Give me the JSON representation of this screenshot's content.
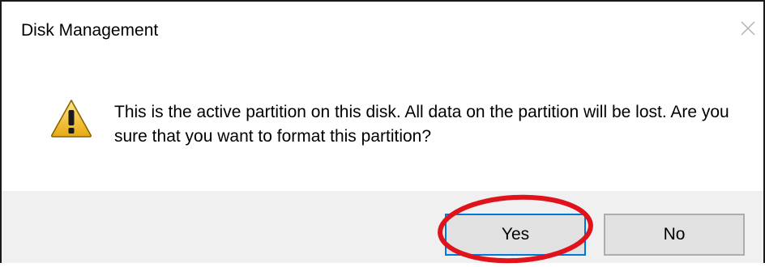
{
  "dialog": {
    "title": "Disk Management",
    "close_icon": "close-icon",
    "warning_icon": "warning-triangle-icon",
    "message": "This is the active partition on this disk. All data on the partition will be lost. Are you sure that you want to format this partition?",
    "buttons": {
      "yes_label": "Yes",
      "no_label": "No"
    }
  },
  "annotation": {
    "highlight_target": "Yes",
    "highlight_color": "#e0121b"
  },
  "colors": {
    "footer_background": "#f0f0f0",
    "button_background": "#e1e1e1",
    "default_button_border": "#0078d7",
    "warning_yellow": "#f7c531"
  }
}
